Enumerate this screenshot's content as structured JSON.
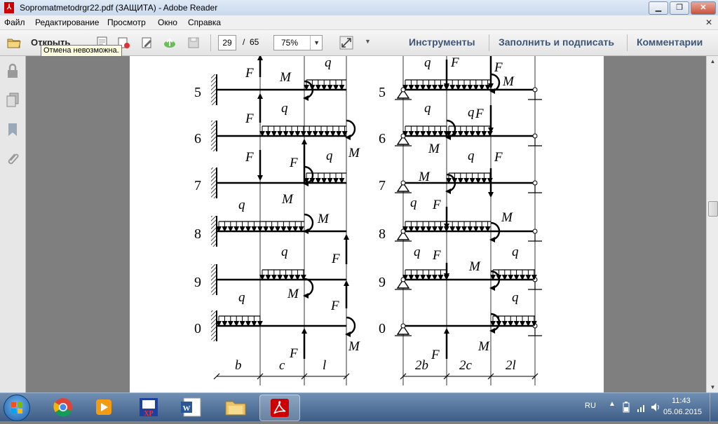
{
  "window": {
    "title": "Sopromatmetodrgr22.pdf (ЗАЩИТА) - Adobe Reader",
    "app_icon": "adobe-reader-icon"
  },
  "menu": {
    "items": [
      "Файл",
      "Редактирование",
      "Просмотр",
      "Окно",
      "Справка"
    ]
  },
  "toolbar": {
    "open_label": "Открыть",
    "page_current": "29",
    "page_sep": "/",
    "page_total": "65",
    "zoom": "75%",
    "tools_label": "Инструменты",
    "fill_sign_label": "Заполнить и подписать",
    "comments_label": "Комментарии"
  },
  "tooltip": {
    "text": "Отмена невозможна."
  },
  "document": {
    "left_rows": [
      "5",
      "6",
      "7",
      "8",
      "9",
      "0"
    ],
    "right_rows": [
      "5",
      "6",
      "7",
      "8",
      "9",
      "0"
    ],
    "labels": {
      "F": "F",
      "M": "M",
      "q": "q"
    },
    "left_dims": [
      "b",
      "c",
      "l"
    ],
    "right_dims": [
      "2b",
      "2c",
      "2l"
    ]
  },
  "taskbar": {
    "apps": [
      "chrome-icon",
      "media-player-icon",
      "xp-icon",
      "word-icon",
      "explorer-icon",
      "adobe-reader-icon"
    ],
    "lang": "RU",
    "time": "11:43",
    "date": "05.06.2015"
  },
  "colors": {
    "label_color": "#3e5674",
    "tooltip_bg": "#ffffe1",
    "reader_red": "#cc0000"
  }
}
